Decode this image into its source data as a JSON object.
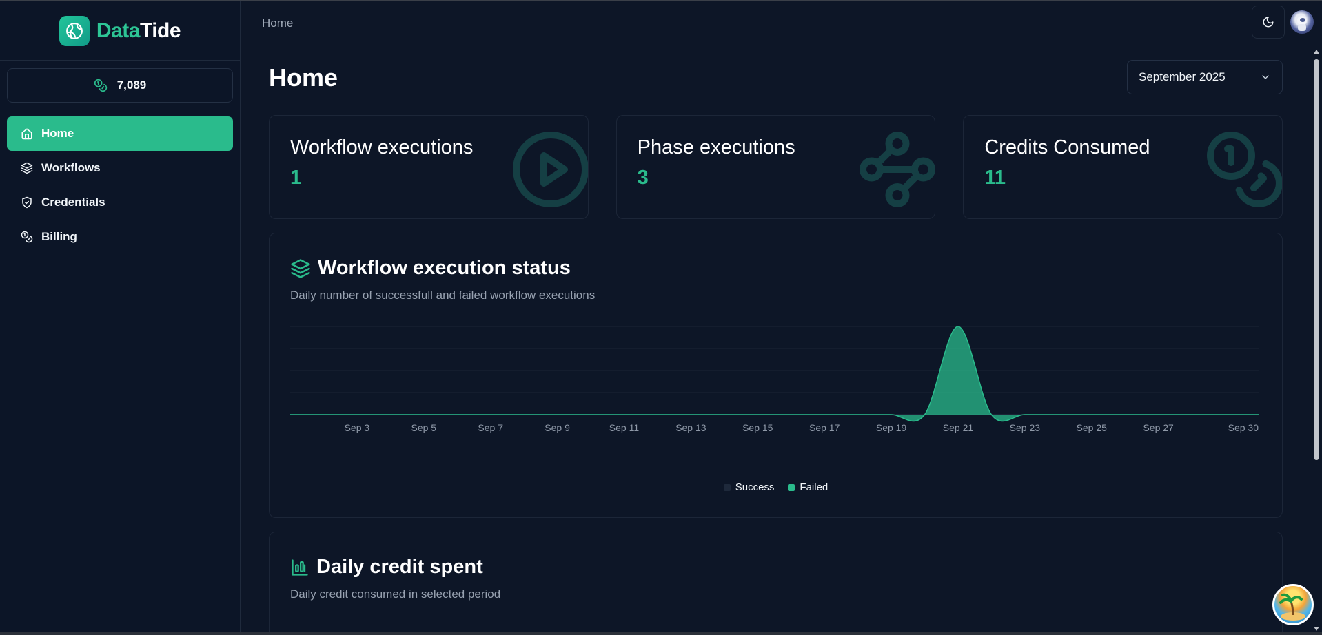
{
  "app": {
    "brand_part1": "Data",
    "brand_part2": "Tide"
  },
  "sidebar": {
    "credits": "7,089",
    "items": [
      {
        "label": "Home",
        "icon": "home-icon",
        "active": true
      },
      {
        "label": "Workflows",
        "icon": "layers-icon",
        "active": false
      },
      {
        "label": "Credentials",
        "icon": "shield-check-icon",
        "active": false
      },
      {
        "label": "Billing",
        "icon": "coins-icon",
        "active": false
      }
    ]
  },
  "header": {
    "breadcrumb": "Home"
  },
  "page": {
    "title": "Home",
    "period": "September 2025"
  },
  "stats": [
    {
      "label": "Workflow executions",
      "value": "1",
      "icon": "circle-play-icon"
    },
    {
      "label": "Phase executions",
      "value": "3",
      "icon": "waypoints-icon"
    },
    {
      "label": "Credits Consumed",
      "value": "11",
      "icon": "coins-icon"
    }
  ],
  "status_panel": {
    "title": "Workflow execution status",
    "subtitle": "Daily number of successfull and failed workflow executions",
    "legend_success": "Success",
    "legend_failed": "Failed"
  },
  "credit_panel": {
    "title": "Daily credit spent",
    "subtitle": "Daily credit consumed in selected period"
  },
  "colors": {
    "accent": "#2abb8c",
    "background": "#0d1627",
    "success": "#1e293b"
  },
  "chart_data": {
    "type": "area",
    "x": [
      "Sep 1",
      "Sep 2",
      "Sep 3",
      "Sep 4",
      "Sep 5",
      "Sep 6",
      "Sep 7",
      "Sep 8",
      "Sep 9",
      "Sep 10",
      "Sep 11",
      "Sep 12",
      "Sep 13",
      "Sep 14",
      "Sep 15",
      "Sep 16",
      "Sep 17",
      "Sep 18",
      "Sep 19",
      "Sep 20",
      "Sep 21",
      "Sep 22",
      "Sep 23",
      "Sep 24",
      "Sep 25",
      "Sep 26",
      "Sep 27",
      "Sep 28",
      "Sep 29",
      "Sep 30"
    ],
    "tick_labels": [
      "Sep 3",
      "Sep 5",
      "Sep 7",
      "Sep 9",
      "Sep 11",
      "Sep 13",
      "Sep 15",
      "Sep 17",
      "Sep 19",
      "Sep 21",
      "Sep 23",
      "Sep 25",
      "Sep 27",
      "Sep 30"
    ],
    "series": [
      {
        "name": "Success",
        "values": [
          0,
          0,
          0,
          0,
          0,
          0,
          0,
          0,
          0,
          0,
          0,
          0,
          0,
          0,
          0,
          0,
          0,
          0,
          0,
          0,
          0,
          0,
          0,
          0,
          0,
          0,
          0,
          0,
          0,
          0
        ]
      },
      {
        "name": "Failed",
        "values": [
          0,
          0,
          0,
          0,
          0,
          0,
          0,
          0,
          0,
          0,
          0,
          0,
          0,
          0,
          0,
          0,
          0,
          0,
          0,
          0,
          1,
          0,
          0,
          0,
          0,
          0,
          0,
          0,
          0,
          0
        ]
      }
    ],
    "ylim": [
      0,
      1
    ],
    "grid": true,
    "legend": "bottom-center"
  }
}
